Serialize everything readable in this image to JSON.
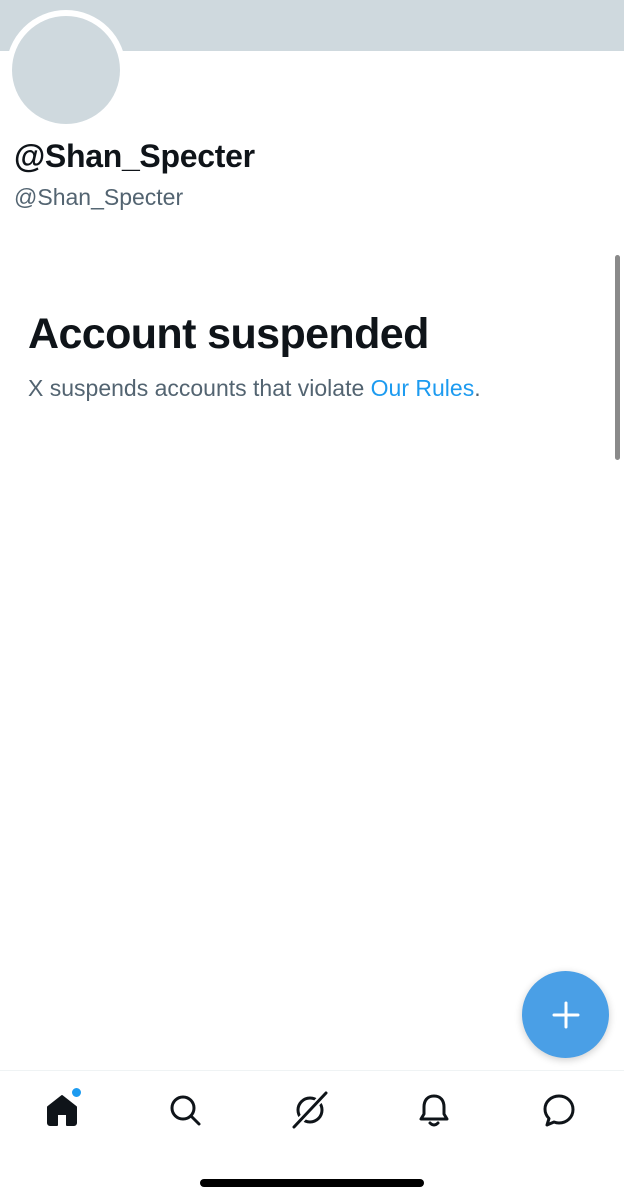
{
  "profile": {
    "display_name": "@Shan_Specter",
    "handle": "@Shan_Specter",
    "avatar": "default-avatar"
  },
  "suspension": {
    "title": "Account suspended",
    "message_prefix": "X suspends accounts that violate ",
    "rules_link": "Our Rules",
    "message_suffix": "."
  },
  "compose": {
    "icon": "plus-icon",
    "color": "#4a9fe6"
  },
  "nav": {
    "items": [
      {
        "name": "home",
        "icon": "home-icon",
        "active": true,
        "has_notification_dot": true
      },
      {
        "name": "search",
        "icon": "search-icon",
        "active": false
      },
      {
        "name": "grok",
        "icon": "grok-icon",
        "active": false
      },
      {
        "name": "notifications",
        "icon": "bell-icon",
        "active": false
      },
      {
        "name": "messages",
        "icon": "message-icon",
        "active": false
      }
    ]
  },
  "colors": {
    "banner": "#cfd9de",
    "accent": "#1d9bf0",
    "text_primary": "#0f1419",
    "text_secondary": "#536471"
  }
}
